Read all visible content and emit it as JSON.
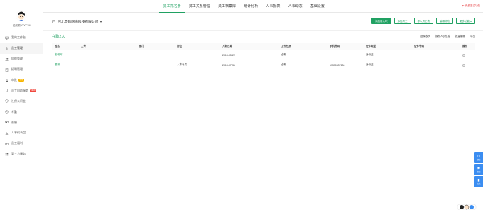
{
  "sidebar": {
    "username": "独孤眼8000C06",
    "items": [
      {
        "label": "我的工作台",
        "icon": "monitor-icon",
        "active": false
      },
      {
        "label": "员工管理",
        "icon": "user-icon",
        "active": true
      },
      {
        "label": "组织管理",
        "icon": "people-icon",
        "active": false
      },
      {
        "label": "招聘管理",
        "icon": "book-icon",
        "active": false
      },
      {
        "label": "审批",
        "icon": "stamp-icon",
        "badge": "待审",
        "badge_color": "#f7b500",
        "active": false
      },
      {
        "label": "员工自助服务",
        "icon": "phone-icon",
        "badge": "NEW",
        "badge_color": "#f0483e",
        "active": false
      },
      {
        "label": "社保公积金",
        "icon": "shield-icon",
        "active": false
      },
      {
        "label": "考勤",
        "icon": "clock-icon",
        "active": false
      },
      {
        "label": "薪酬",
        "icon": "money-icon",
        "active": false
      },
      {
        "label": "人事仪表盘",
        "icon": "chart-icon",
        "active": false
      },
      {
        "label": "员工福利",
        "icon": "gift-icon",
        "active": false
      },
      {
        "label": "第三方服务",
        "icon": "grid-icon",
        "active": false
      }
    ]
  },
  "topbar": {
    "tabs": [
      "员工花名册",
      "员工关系管理",
      "员工档案库",
      "统计分析",
      "人事报表",
      "人事动态",
      "基础设置"
    ],
    "active_tab": 0,
    "right_link": "免费重试功能"
  },
  "company": {
    "name": "河北鼎魏网络科技有限公司"
  },
  "actions": {
    "add_onboarding": "添加待入职",
    "add_employee": "添加员工",
    "import_employee": "导入员工表",
    "batch_modify": "编辑修改",
    "more": "更多功能"
  },
  "list": {
    "count_label": "在职2人",
    "tools": [
      "选择表头",
      "操作人员信息",
      "批量编辑",
      "导出"
    ],
    "columns": [
      "姓名",
      "工号",
      "部门",
      "岗位",
      "入职日期",
      "工作性质",
      "手机号码",
      "证件类型",
      "证件号码",
      "操作"
    ],
    "rows": [
      {
        "name": "彭朝晖",
        "job_no": "",
        "dept": "",
        "post": "",
        "date": "2019-05-22",
        "type": "全职",
        "phone": "",
        "id_type": "身份证",
        "id_no": ""
      },
      {
        "name": "董琳",
        "job_no": "",
        "dept": "",
        "post": "人事专员",
        "date": "2019-07-31",
        "type": "全职",
        "phone": "17330537630",
        "id_type": "身份证",
        "id_no": ""
      }
    ]
  },
  "floaters": [
    {
      "label": "帮助",
      "icon": "help-icon"
    },
    {
      "label": "客服",
      "icon": "chat-icon"
    },
    {
      "label": "文档",
      "icon": "doc-icon"
    }
  ],
  "colors": {
    "accent": "#20a162",
    "helper_blue": "#3b8df1",
    "alert_red": "#e4393c"
  }
}
